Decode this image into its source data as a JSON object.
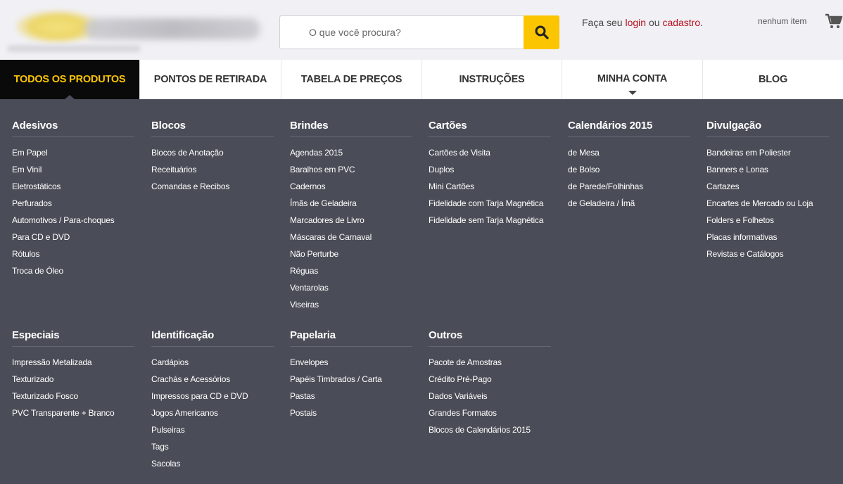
{
  "search": {
    "placeholder": "O que você procura?"
  },
  "account": {
    "prefix": "Faça seu ",
    "login": "login",
    "middle": " ou ",
    "signup": "cadastro",
    "suffix": "."
  },
  "cart": {
    "label": "nenhum item"
  },
  "nav": [
    {
      "label": "TODOS OS PRODUTOS"
    },
    {
      "label": "PONTOS DE RETIRADA"
    },
    {
      "label": "TABELA DE PREÇOS"
    },
    {
      "label": "INSTRUÇÕES"
    },
    {
      "label": "MINHA CONTA"
    },
    {
      "label": "BLOG"
    }
  ],
  "menu": [
    {
      "title": "Adesivos",
      "items": [
        "Em Papel",
        "Em Vinil",
        "Eletrostáticos",
        "Perfurados",
        "Automotivos / Para-choques",
        "Para CD e DVD",
        "Rótulos",
        "Troca de Óleo"
      ]
    },
    {
      "title": "Blocos",
      "items": [
        "Blocos de Anotação",
        "Receituários",
        "Comandas e Recibos"
      ]
    },
    {
      "title": "Brindes",
      "items": [
        "Agendas 2015",
        "Baralhos em PVC",
        "Cadernos",
        "Ímãs de Geladeira",
        "Marcadores de Livro",
        "Máscaras de Carnaval",
        "Não Perturbe",
        "Réguas",
        "Ventarolas",
        "Viseiras"
      ]
    },
    {
      "title": "Cartões",
      "items": [
        "Cartões de Visita",
        "Duplos",
        "Mini Cartões",
        "Fidelidade com Tarja Magnética",
        "Fidelidade sem Tarja Magnética"
      ]
    },
    {
      "title": "Calendários 2015",
      "items": [
        "de Mesa",
        "de Bolso",
        "de Parede/Folhinhas",
        "de Geladeira / Ímã"
      ]
    },
    {
      "title": "Divulgação",
      "items": [
        "Bandeiras em Poliester",
        "Banners e Lonas",
        "Cartazes",
        "Encartes de Mercado ou Loja",
        "Folders e Folhetos",
        "Placas informativas",
        "Revistas e Catálogos"
      ]
    },
    {
      "title": "Especiais",
      "items": [
        "Impressão Metalizada",
        "Texturizado",
        "Texturizado Fosco",
        "PVC Transparente + Branco"
      ]
    },
    {
      "title": "Identificação",
      "items": [
        "Cardápios",
        "Crachás e Acessórios",
        "Impressos para CD e DVD",
        "Jogos Americanos",
        "Pulseiras",
        "Tags",
        "Sacolas"
      ]
    },
    {
      "title": "Papelaria",
      "items": [
        "Envelopes",
        "Papéis Timbrados / Carta",
        "Pastas",
        "Postais"
      ]
    },
    {
      "title": "Outros",
      "items": [
        "Pacote de Amostras",
        "Crédito Pré-Pago",
        "Dados Variáveis",
        "Grandes Formatos",
        "Blocos de Calendários 2015"
      ]
    }
  ],
  "colors": {
    "accent": "#fbc502",
    "menu_bg": "#4a4d57",
    "link_red": "#b5101d"
  }
}
